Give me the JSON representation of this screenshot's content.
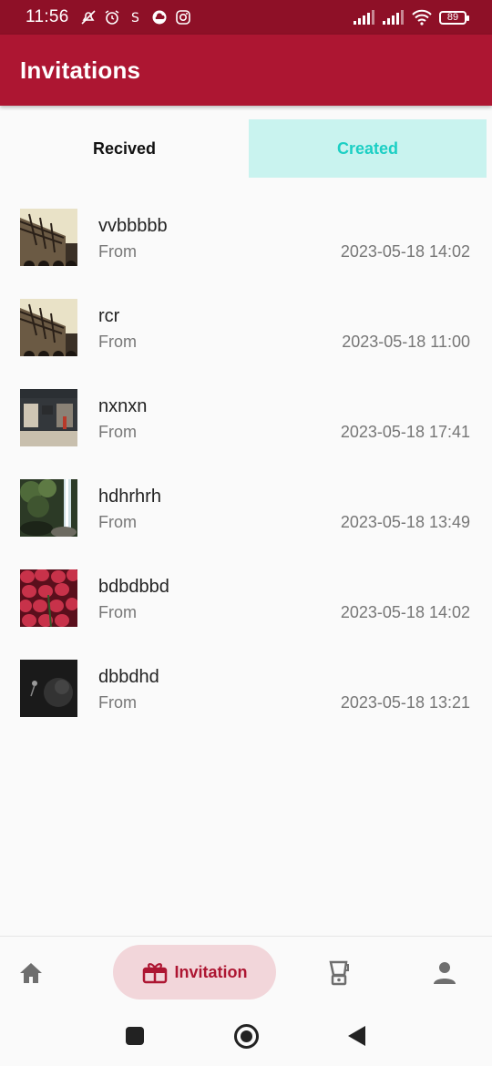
{
  "status_bar": {
    "time": "11:56",
    "battery": "89",
    "icons": [
      "mute-icon",
      "alarm-icon",
      "s-app-icon",
      "cloud-icon",
      "instagram-icon",
      "signal-icon",
      "signal-icon",
      "wifi-icon",
      "battery-icon"
    ]
  },
  "app_bar": {
    "title": "Invitations"
  },
  "tabs": [
    {
      "label": "Recived",
      "selected": false
    },
    {
      "label": "Created",
      "selected": true
    }
  ],
  "invitations": [
    {
      "title": "vvbbbbb",
      "subtitle": "From",
      "date": "2023-05-18 14:02",
      "thumbnail": "building-photo"
    },
    {
      "title": "rcr",
      "subtitle": "From",
      "date": "2023-05-18 11:00",
      "thumbnail": "building-photo"
    },
    {
      "title": "nxnxn",
      "subtitle": "From",
      "date": "2023-05-18 17:41",
      "thumbnail": "storefront-photo"
    },
    {
      "title": "hdhrhrh",
      "subtitle": "From",
      "date": "2023-05-18 13:49",
      "thumbnail": "waterfall-photo"
    },
    {
      "title": "bdbdbbd",
      "subtitle": "From",
      "date": "2023-05-18 14:02",
      "thumbnail": "strawberries-photo"
    },
    {
      "title": "dbbdhd",
      "subtitle": "From",
      "date": "2023-05-18 13:21",
      "thumbnail": "dark-photo"
    }
  ],
  "bottom_nav": {
    "items": [
      {
        "icon": "home-icon",
        "label": ""
      },
      {
        "icon": "gift-icon",
        "label": "Invitation",
        "active": true
      },
      {
        "icon": "blender-icon",
        "label": ""
      },
      {
        "icon": "person-icon",
        "label": ""
      }
    ]
  },
  "colors": {
    "status_bar": "#8e1027",
    "app_bar": "#ad1632",
    "tab_selected_bg": "#c9f3ef",
    "tab_selected_text": "#1ccfc4",
    "nav_active_bg": "#f2d6da"
  }
}
